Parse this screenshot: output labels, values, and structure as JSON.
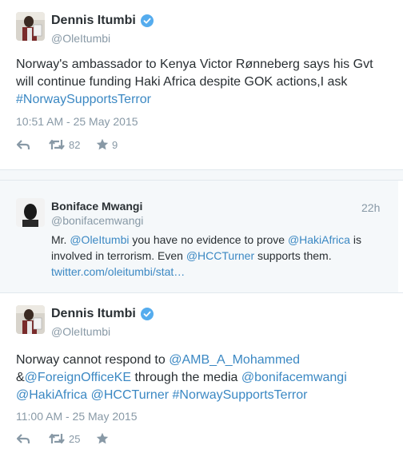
{
  "tweet1": {
    "name": "Dennis Itumbi",
    "handle": "@OleItumbi",
    "text_parts": [
      "Norway's ambassador to Kenya Victor Rønneberg says his Gvt will continue funding Haki Africa despite GOK actions,I ask ",
      "#NorwaySupportsTerror"
    ],
    "timestamp": "10:51 AM - 25 May 2015",
    "retweets": "82",
    "likes": "9"
  },
  "reply": {
    "name": "Boniface Mwangi",
    "handle": "@bonifacemwangi",
    "age": "22h",
    "parts": [
      "Mr. ",
      "@OleItumbi",
      " you have no evidence to prove ",
      "@HakiAfrica",
      " is involved in terrorism. Even ",
      "@HCCTurner",
      " supports them. ",
      "twitter.com/oleitumbi/stat…"
    ]
  },
  "tweet2": {
    "name": "Dennis Itumbi",
    "handle": "@OleItumbi",
    "parts": [
      "Norway cannot respond to ",
      "@AMB_A_Mohammed",
      " &",
      "@ForeignOfficeKE",
      " through the media ",
      "@bonifacemwangi",
      " ",
      "@HakiAfrica",
      " ",
      "@HCCTurner",
      " ",
      "#NorwaySupportsTerror"
    ],
    "timestamp": "11:00 AM - 25 May 2015",
    "retweets": "25"
  },
  "colors": {
    "link": "#3b88c3",
    "verified": "#55acee",
    "muted": "#8899a6"
  },
  "icons": [
    "reply-icon",
    "retweet-icon",
    "favorite-icon",
    "verified-badge-icon"
  ]
}
